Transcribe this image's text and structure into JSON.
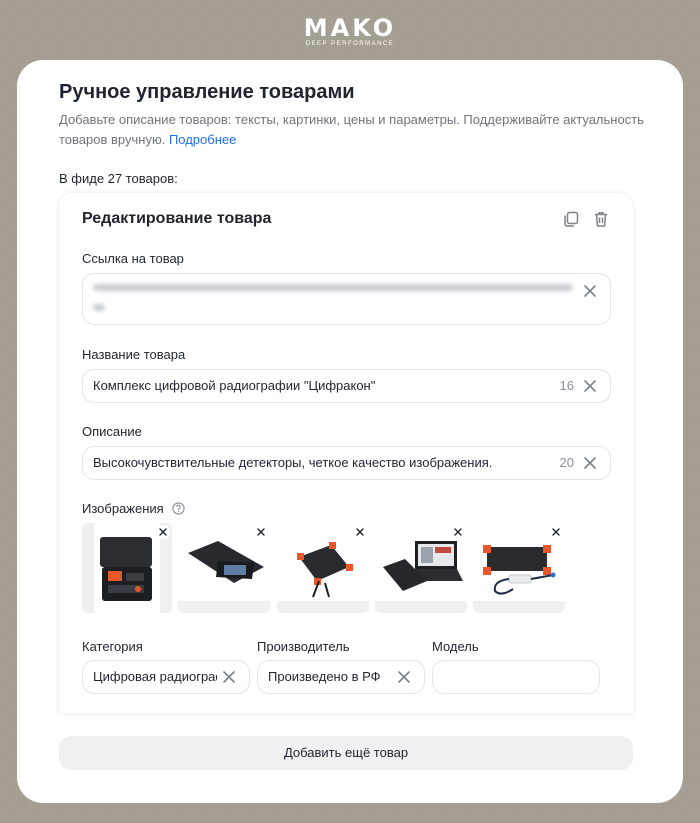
{
  "logo": {
    "brand": "MAKO",
    "tagline": "DEEP PERFORMANCE"
  },
  "header": {
    "title": "Ручное управление товарами",
    "subtitle": "Добавьте описание товаров: тексты, картинки, цены и параметры. Поддерживайте актуальность товаров вручную.",
    "more_link": "Подробнее"
  },
  "feed_count": "В фиде 27 товаров:",
  "card": {
    "title": "Редактирование товара",
    "url_label": "Ссылка на товар",
    "name_label": "Название товара",
    "name_value": "Комплекс цифровой радиографии \"Цифракон\"",
    "name_counter": "16",
    "desc_label": "Описание",
    "desc_value": "Высокочувствительные детекторы, четкое качество изображения.",
    "desc_counter": "20",
    "images_label": "Изображения",
    "category_label": "Категория",
    "category_value": "Цифровая радиография",
    "maker_label": "Производитель",
    "maker_value": "Произведено в РФ",
    "model_label": "Модель",
    "model_value": ""
  },
  "add_button": "Добавить ещё товар",
  "icons": [
    "copy-icon",
    "trash-icon",
    "clear-icon",
    "help-icon",
    "remove-image-icon"
  ],
  "colors": {
    "link": "#1f6feb",
    "background": "#a39c90",
    "accent_orange": "#e8562a"
  }
}
